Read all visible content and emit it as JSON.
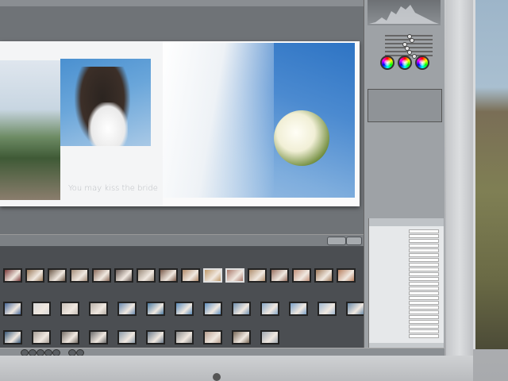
{
  "viewer": {
    "caption": "You may kiss the bride",
    "bar_buttons": [
      "",
      ""
    ],
    "bar_info": ""
  },
  "inspector": {
    "panels": [
      "",
      "",
      ""
    ],
    "sliders": [
      {
        "label": "",
        "value": 0.5
      },
      {
        "label": "",
        "value": 0.55
      },
      {
        "label": "",
        "value": 0.4
      },
      {
        "label": "",
        "value": 0.45
      },
      {
        "label": "",
        "value": 0.5
      },
      {
        "label": "",
        "value": 0.6
      }
    ],
    "colors": {
      "accent": "#9ea2a6",
      "wheel_border": "#333333"
    }
  },
  "metadata": {
    "header": "",
    "rows": [
      {
        "key": ""
      },
      {
        "key": ""
      },
      {
        "key": ""
      },
      {
        "key": ""
      },
      {
        "key": ""
      },
      {
        "key": ""
      },
      {
        "key": ""
      },
      {
        "key": ""
      },
      {
        "key": ""
      },
      {
        "key": ""
      },
      {
        "key": ""
      },
      {
        "key": ""
      },
      {
        "key": ""
      },
      {
        "key": ""
      },
      {
        "key": ""
      },
      {
        "key": ""
      },
      {
        "key": ""
      },
      {
        "key": ""
      },
      {
        "key": ""
      },
      {
        "key": ""
      },
      {
        "key": ""
      },
      {
        "key": ""
      },
      {
        "key": ""
      }
    ],
    "footer": ""
  },
  "browser": {
    "info": "",
    "thumbnail_colors": [
      [
        "#7a3a3a",
        "#9a7a5a",
        "#6d5a4a",
        "#a58e7a",
        "#8a6a5a",
        "#6a5a54",
        "#9a8a7a",
        "#7a5a4a",
        "#b08a6a",
        "#c09a6a",
        "#a8786a",
        "#b09070",
        "#987060",
        "#c0907a",
        "#a07a5a",
        "#b88060"
      ],
      [
        "#4a6a9a",
        "#d8d8d8",
        "#c8c0b8",
        "#b8b0a8",
        "#6a8ab0",
        "#4a7aa0",
        "#5a8ab8",
        "#6090c0",
        "#7090b0",
        "#88a8c8",
        "#7aa0c8",
        "#a0b8d0",
        "#6a8aa8"
      ],
      [
        "#3a5a7a",
        "#a8a098",
        "#787068",
        "#6a6a6a",
        "#8a9aa8",
        "#6a7a8a",
        "#8a8a8a",
        "#b8a090",
        "#7a6a5a",
        "#a0a8b0"
      ]
    ]
  },
  "bottom_bar": {
    "labels": [
      "",
      "",
      "",
      "",
      "",
      "",
      "",
      ""
    ]
  }
}
